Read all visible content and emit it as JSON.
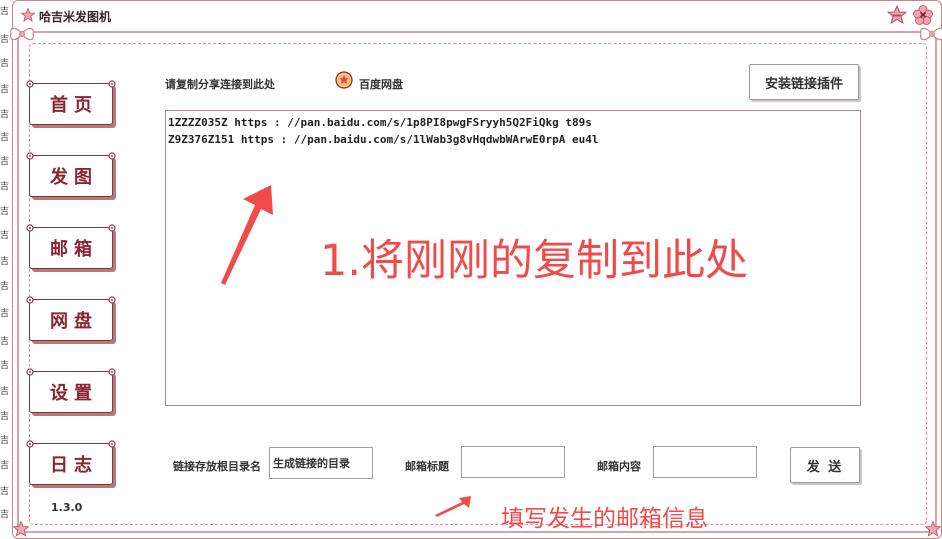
{
  "window": {
    "title": "哈吉米发图机"
  },
  "nav": [
    {
      "label": "首页"
    },
    {
      "label": "发图"
    },
    {
      "label": "邮箱"
    },
    {
      "label": "网盘"
    },
    {
      "label": "设置"
    },
    {
      "label": "日志"
    }
  ],
  "version": "1.3.0",
  "header": {
    "copy_label": "请复制分享连接到此处",
    "pan_label": "百度网盘",
    "install_button": "安装链接插件"
  },
  "links_text": [
    "1ZZZZ035Z https : //pan.baidu.com/s/1p8PI8pwgFSryyh5Q2FiQkg t89s",
    "Z9Z376Z151 https : //pan.baidu.com/s/1lWab3g8vHqdwbWArwE0rpA eu4l"
  ],
  "annotations": {
    "paste_hint": "1.将刚刚的复制到此处",
    "email_hint": "填写发生的邮箱信息"
  },
  "form": {
    "root_dir_label": "链接存放根目录名",
    "root_dir_value": "生成链接的目录",
    "subject_label": "邮箱标题",
    "subject_value": "",
    "content_label": "邮箱内容",
    "content_value": "",
    "send_button": "发 送"
  },
  "colors": {
    "accent": "#8a2433",
    "border_pink": "#e58b97",
    "annotation_red": "#f24a4a"
  },
  "icons": {
    "title": "pink-star-icon",
    "window_controls": [
      "star-minimize-icon",
      "flower-close-icon"
    ],
    "pan": "baidu-pan-icon"
  }
}
